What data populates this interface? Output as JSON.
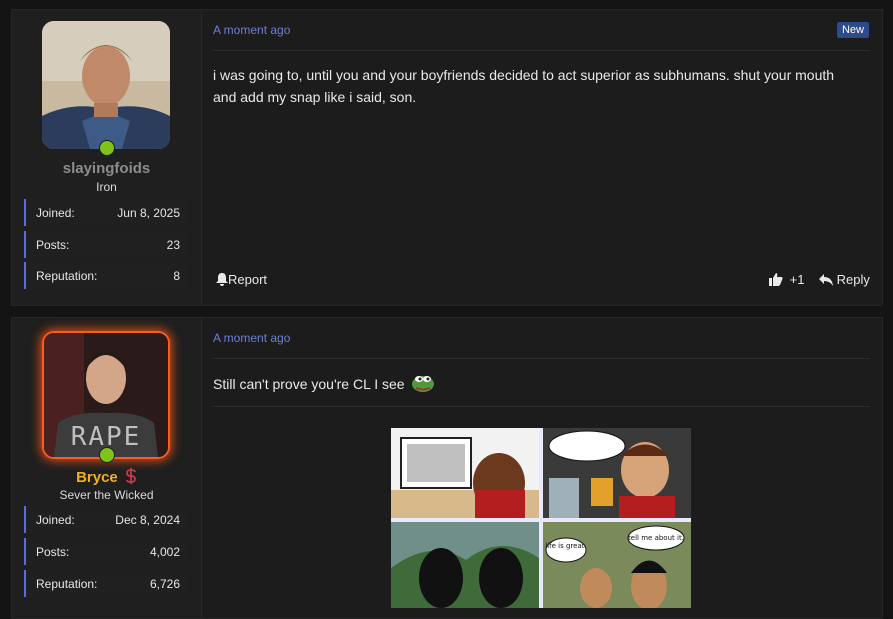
{
  "posts": [
    {
      "username": "slayingfoids",
      "user_title": "Iron",
      "stats": [
        {
          "label": "Joined:",
          "value": "Jun 8, 2025"
        },
        {
          "label": "Posts:",
          "value": "23"
        },
        {
          "label": "Reputation:",
          "value": "8"
        }
      ],
      "time": "A moment ago",
      "badge": "New",
      "message": "i was going to, until you and your boyfriends decided to act superior as subhumans. shut your mouth and add my snap like i said, son.",
      "report_label": "Report",
      "like_count": "+1",
      "reply_label": "Reply"
    },
    {
      "username": "Bryce",
      "user_title": "Sever the Wicked",
      "stats": [
        {
          "label": "Joined:",
          "value": "Dec 8, 2024"
        },
        {
          "label": "Posts:",
          "value": "4,002"
        },
        {
          "label": "Reputation:",
          "value": "6,726"
        }
      ],
      "time": "A moment ago",
      "message": "Still can't prove you're CL I see",
      "comic_bubbles": [
        "life is great.",
        "tell me about it."
      ]
    }
  ],
  "colors": {
    "accent": "#6b7fd7",
    "online": "#7ec21a",
    "username_gold": "#f2b01e",
    "new_badge": "#2d4a8a"
  },
  "icons": [
    "online-dot-icon",
    "bell-icon",
    "thumbs-up-icon",
    "reply-arrow-icon",
    "dollar-icon",
    "pepe-emoji-icon"
  ]
}
